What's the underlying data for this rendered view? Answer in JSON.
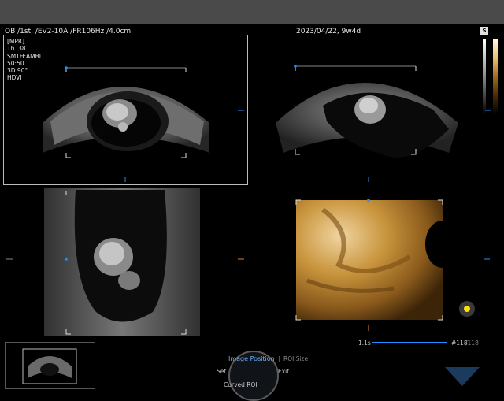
{
  "header": {
    "exam_info": "OB /1st, /EV2-10A /FR106Hz /4.0cm",
    "date_ga": "2023/04/22, 9w4d",
    "probe_badge": "S"
  },
  "mpr_info": {
    "lines": [
      "[MPR]",
      "Th. 38",
      "SMTH:AMBI",
      "50:50",
      "3D 90°",
      "HDVI"
    ]
  },
  "cine": {
    "speed": "1.1s",
    "frame": "#118",
    "total": "/118"
  },
  "controls": {
    "image_position": "Image Position",
    "separator": "|",
    "roi_size": "ROI Size",
    "set": "Set",
    "exit": "Exit",
    "curved_roi": "Curved ROI"
  },
  "colors": {
    "accent": "#1e90ff",
    "tint_3d": "#c8943c",
    "cursor": "#ffe000"
  }
}
